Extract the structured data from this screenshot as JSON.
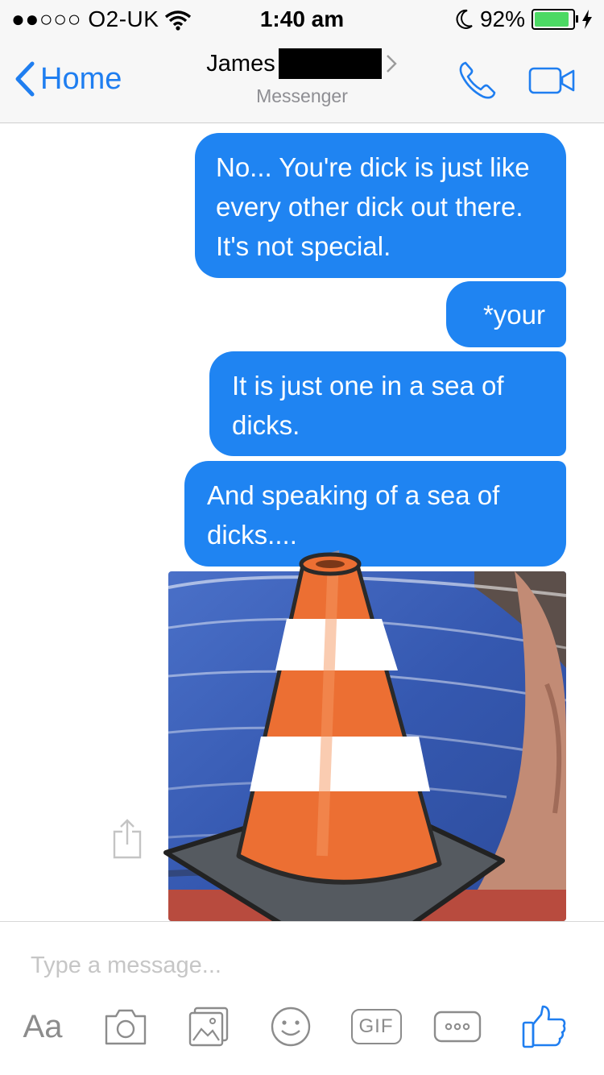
{
  "status_bar": {
    "carrier": "●●○○○ O2-UK",
    "time": "1:40 am",
    "battery": "92%",
    "battery_level": 0.92
  },
  "nav": {
    "back_label": "Home",
    "contact_name": "James",
    "subtitle": "Messenger"
  },
  "messages": [
    {
      "text": "No... You're dick is just like every other dick out there. It's not special."
    },
    {
      "text": "*your"
    },
    {
      "text": "It is just one in a sea of dicks."
    },
    {
      "text": "And speaking of a sea of dicks...."
    }
  ],
  "composer": {
    "placeholder": "Type a message...",
    "aa_label": "Aa",
    "gif_label": "GIF"
  },
  "colors": {
    "accent": "#1f7ef0",
    "bubble": "#1f84f2",
    "cone_orange": "#ec6f33",
    "shirt_blue": "#3c5fb8"
  },
  "icons": [
    "wifi-icon",
    "moon-icon",
    "battery-icon",
    "charging-icon",
    "chevron-left-icon",
    "chevron-right-icon",
    "phone-icon",
    "video-camera-icon",
    "share-icon",
    "camera-icon",
    "gallery-icon",
    "emoji-icon",
    "more-icon",
    "thumbs-up-icon"
  ]
}
